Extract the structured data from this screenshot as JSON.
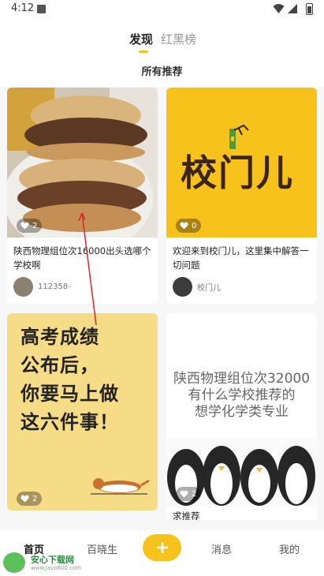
{
  "status_bar": {
    "time": "4:12",
    "icons": [
      "notification-icon",
      "wifi-icon",
      "signal-icon",
      "battery-icon"
    ]
  },
  "header": {
    "tabs": [
      {
        "label": "发现",
        "active": true
      },
      {
        "label": "红黑榜",
        "active": false
      }
    ],
    "section_title": "所有推荐"
  },
  "feed": [
    {
      "title": "陕西物理组位次16000出头选哪个学校啊",
      "likes": "2",
      "author": "112358-",
      "image": "food-photo"
    },
    {
      "title": "欢迎来到校门儿，这里集中解答一切问题",
      "likes": "0",
      "author": "校门儿",
      "image_text": "校门儿"
    },
    {
      "poster_lines": [
        "高考成绩",
        "公布后，",
        "你要马上做",
        "这六件事！"
      ],
      "likes": "2",
      "image": "dog-illustration"
    },
    {
      "image_lines": [
        "陕西物理组位次32000",
        "有什么学校推荐的",
        "想学化学类专业"
      ],
      "likes": "2",
      "title": "求推荐",
      "image": "penguins"
    }
  ],
  "bottom_nav": {
    "items": [
      "首页",
      "百晓生",
      "消息",
      "我的"
    ],
    "active": "首页"
  },
  "watermark": {
    "title": "安心下载网",
    "url": "www.java800.com"
  },
  "colors": {
    "accent": "#f8c21c",
    "background": "#f7f7f7"
  }
}
